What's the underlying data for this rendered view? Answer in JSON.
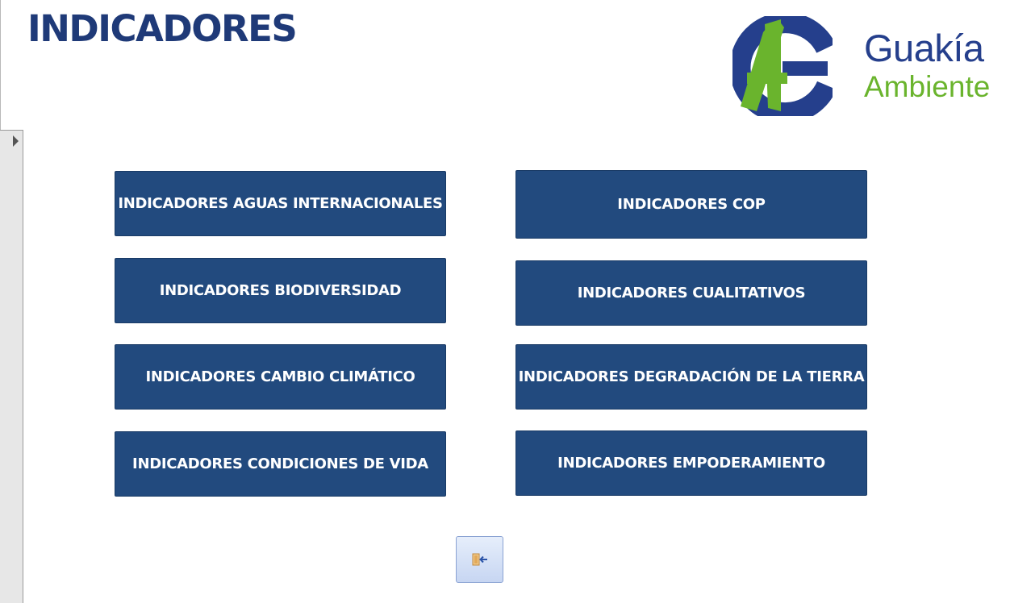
{
  "page": {
    "title": "INDICADORES"
  },
  "logo": {
    "initials": "AG",
    "name_line1": "Guakía",
    "name_line2": "Ambiente",
    "colors": {
      "green": "#6ab42d",
      "blue": "#253f8c"
    }
  },
  "buttons": [
    {
      "id": "aguas",
      "label": "INDICADORES AGUAS INTERNACIONALES"
    },
    {
      "id": "cop",
      "label": "INDICADORES COP"
    },
    {
      "id": "biodiversidad",
      "label": "INDICADORES BIODIVERSIDAD"
    },
    {
      "id": "cualitativos",
      "label": "INDICADORES CUALITATIVOS"
    },
    {
      "id": "cambio-climatico",
      "label": "INDICADORES CAMBIO CLIMÁTICO"
    },
    {
      "id": "degradacion",
      "label": "INDICADORES DEGRADACIÓN DE LA TIERRA"
    },
    {
      "id": "condiciones-vida",
      "label": "INDICADORES CONDICIONES DE VIDA"
    },
    {
      "id": "empoderamiento",
      "label": "INDICADORES EMPODERAMIENTO"
    }
  ],
  "back_button": {
    "icon": "exit-door-arrow-icon"
  },
  "colors": {
    "title": "#1f3a78",
    "button_bg": "#224a7e",
    "button_text": "#ffffff"
  }
}
